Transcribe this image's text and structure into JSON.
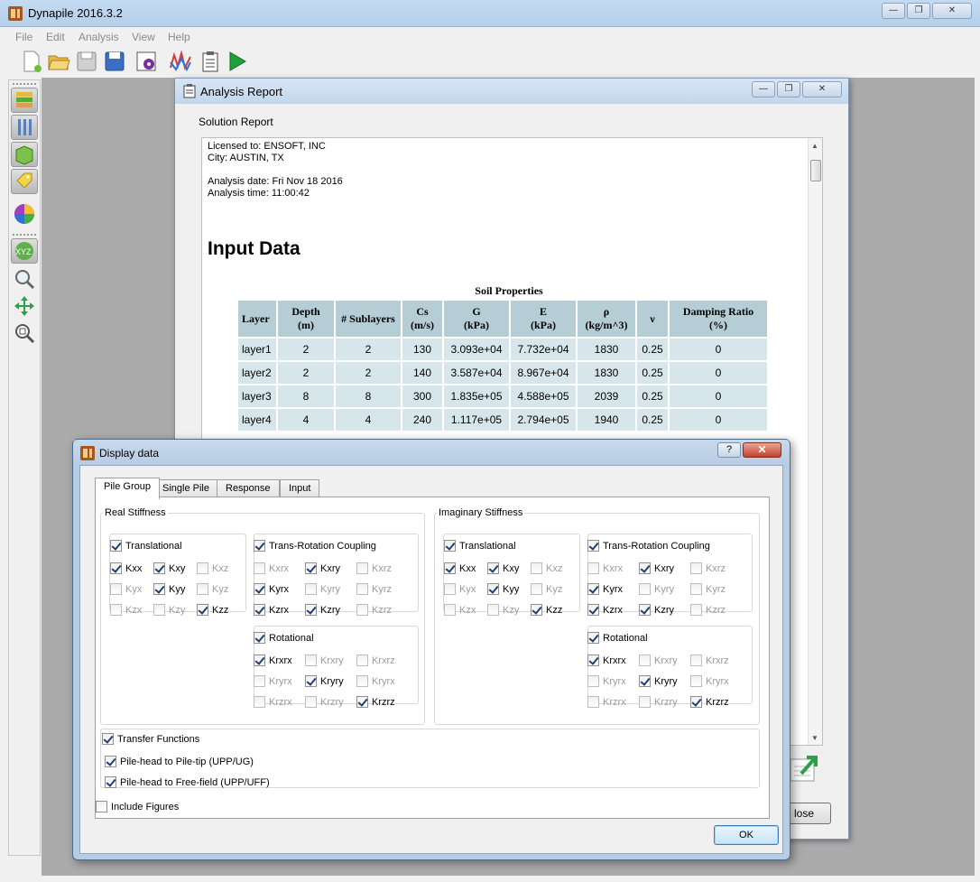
{
  "app": {
    "title": "Dynapile 2016.3.2"
  },
  "menu": [
    "File",
    "Edit",
    "Analysis",
    "View",
    "Help"
  ],
  "toolbar": [
    "new-file-icon",
    "open-folder-icon",
    "save-icon",
    "save-as-icon",
    "settings-icon",
    "chart-icon",
    "report-icon",
    "run-icon"
  ],
  "left_toolbar": [
    "soil-layers-icon",
    "pile-icon",
    "pile-group-icon",
    "tag-icon",
    "color-wheel-icon",
    "xyz-view-icon",
    "zoom-icon",
    "pan-icon",
    "zoom-extents-icon"
  ],
  "report": {
    "title": "Analysis Report",
    "group_label": "Solution Report",
    "lines": [
      "Licensed to: ENSOFT, INC",
      "City: AUSTIN, TX",
      "Analysis date: Fri Nov 18 2016",
      "Analysis time: 11:00:42"
    ],
    "heading": "Input Data",
    "table_caption": "Soil Properties",
    "headers": [
      {
        "l1": "Layer",
        "l2": ""
      },
      {
        "l1": "Depth",
        "l2": "(m)"
      },
      {
        "l1": "# Sublayers",
        "l2": ""
      },
      {
        "l1": "Cs",
        "l2": "(m/s)"
      },
      {
        "l1": "G",
        "l2": "(kPa)"
      },
      {
        "l1": "E",
        "l2": "(kPa)"
      },
      {
        "l1": "ρ",
        "l2": "(kg/m^3)"
      },
      {
        "l1": "ν",
        "l2": ""
      },
      {
        "l1": "Damping Ratio",
        "l2": "(%)"
      }
    ],
    "rows": [
      [
        "layer1",
        "2",
        "2",
        "130",
        "3.093e+04",
        "7.732e+04",
        "1830",
        "0.25",
        "0"
      ],
      [
        "layer2",
        "2",
        "2",
        "140",
        "3.587e+04",
        "8.967e+04",
        "1830",
        "0.25",
        "0"
      ],
      [
        "layer3",
        "8",
        "8",
        "300",
        "1.835e+05",
        "4.588e+05",
        "2039",
        "0.25",
        "0"
      ],
      [
        "layer4",
        "4",
        "4",
        "240",
        "1.117e+05",
        "2.794e+05",
        "1940",
        "0.25",
        "0"
      ]
    ],
    "close_label": "lose"
  },
  "dialog": {
    "title": "Display data",
    "help_label": "?",
    "close_label": "✕",
    "tabs": [
      "Pile Group",
      "Single Pile",
      "Response",
      "Input"
    ],
    "real_title": "Real Stiffness",
    "imag_title": "Imaginary Stiffness",
    "translational": {
      "label": "Translational",
      "checked": true,
      "items": [
        {
          "label": "Kxx",
          "checked": true,
          "enabled": true
        },
        {
          "label": "Kxy",
          "checked": true,
          "enabled": true
        },
        {
          "label": "Kxz",
          "checked": false,
          "enabled": false
        },
        {
          "label": "Kyx",
          "checked": false,
          "enabled": false
        },
        {
          "label": "Kyy",
          "checked": true,
          "enabled": true
        },
        {
          "label": "Kyz",
          "checked": false,
          "enabled": false
        },
        {
          "label": "Kzx",
          "checked": false,
          "enabled": false
        },
        {
          "label": "Kzy",
          "checked": false,
          "enabled": false
        },
        {
          "label": "Kzz",
          "checked": true,
          "enabled": true
        }
      ]
    },
    "coupling": {
      "label": "Trans-Rotation Coupling",
      "checked": true,
      "items": [
        {
          "label": "Kxrx",
          "checked": false,
          "enabled": false
        },
        {
          "label": "Kxry",
          "checked": true,
          "enabled": true
        },
        {
          "label": "Kxrz",
          "checked": false,
          "enabled": false
        },
        {
          "label": "Kyrx",
          "checked": true,
          "enabled": true
        },
        {
          "label": "Kyry",
          "checked": false,
          "enabled": false
        },
        {
          "label": "Kyrz",
          "checked": false,
          "enabled": false
        },
        {
          "label": "Kzrx",
          "checked": true,
          "enabled": true
        },
        {
          "label": "Kzry",
          "checked": true,
          "enabled": true
        },
        {
          "label": "Kzrz",
          "checked": false,
          "enabled": false
        }
      ]
    },
    "rotational": {
      "label": "Rotational",
      "checked": true,
      "items": [
        {
          "label": "Krxrx",
          "checked": true,
          "enabled": true
        },
        {
          "label": "Krxry",
          "checked": false,
          "enabled": false
        },
        {
          "label": "Krxrz",
          "checked": false,
          "enabled": false
        },
        {
          "label": "Kryrx",
          "checked": false,
          "enabled": false
        },
        {
          "label": "Kryry",
          "checked": true,
          "enabled": true
        },
        {
          "label": "Kryrx",
          "checked": false,
          "enabled": false
        },
        {
          "label": "Krzrx",
          "checked": false,
          "enabled": false
        },
        {
          "label": "Krzry",
          "checked": false,
          "enabled": false
        },
        {
          "label": "Krzrz",
          "checked": true,
          "enabled": true
        }
      ]
    },
    "transfer": {
      "label": "Transfer Functions",
      "checked": true,
      "items": [
        {
          "label": "Pile-head to Pile-tip (UPP/UG)",
          "checked": true
        },
        {
          "label": "Pile-head to Free-field (UPP/UFF)",
          "checked": true
        }
      ]
    },
    "include_figures": {
      "label": "Include Figures",
      "checked": false
    },
    "ok_label": "OK"
  }
}
